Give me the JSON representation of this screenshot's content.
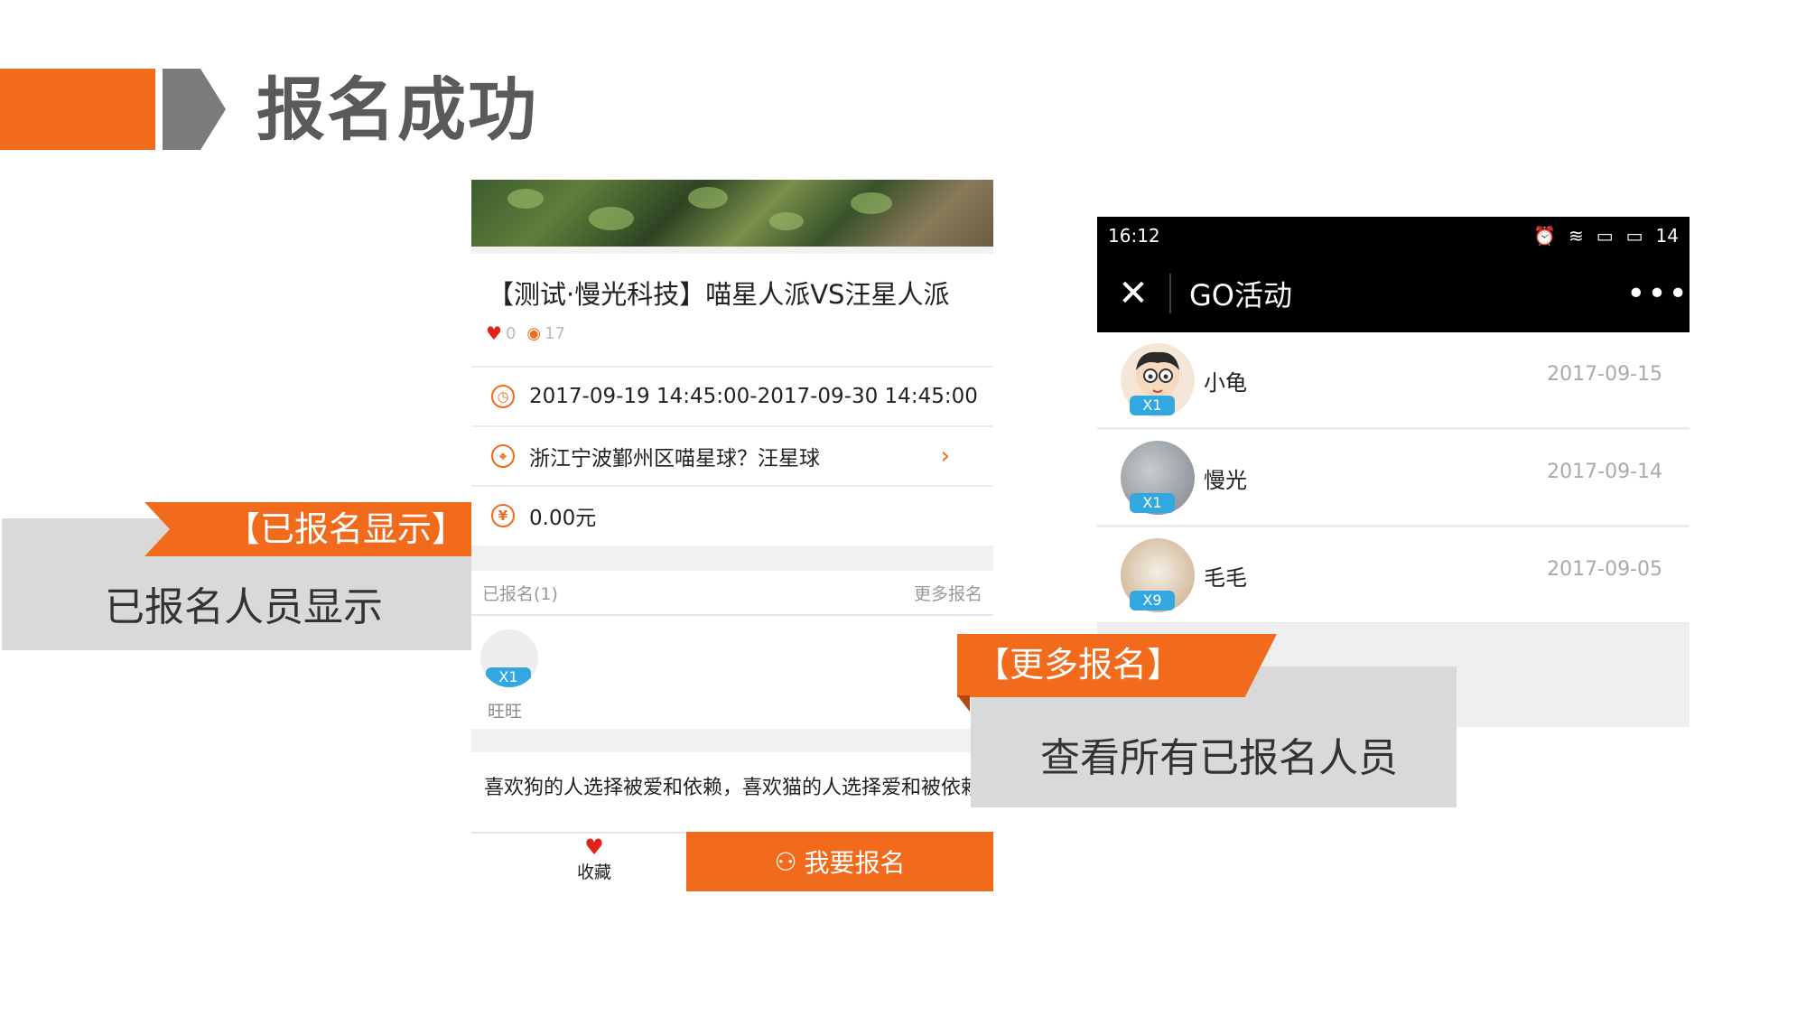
{
  "slide": {
    "title": "报名成功",
    "accent": "#f26b1d",
    "gray": "#7b7b7b"
  },
  "event_page": {
    "title": "【测试·慢光科技】喵星人派VS汪星人派",
    "likes": "0",
    "views": "17",
    "time": "2017-09-19 14:45:00-2017-09-30 14:45:00",
    "location": "浙江宁波鄞州区喵星球？汪星球",
    "price": "0.00元",
    "registered_label": "已报名(1)",
    "more_label": "更多报名",
    "attendee": {
      "name": "旺旺",
      "badge": "X1"
    },
    "description": "喜欢狗的人选择被爱和依赖，喜欢猫的人选择爱和被依赖",
    "favorite_label": "收藏",
    "join_label": "我要报名"
  },
  "callout_left": {
    "tag": "【已报名显示】",
    "text": "已报名人员显示"
  },
  "list_page": {
    "status_time": "16:12",
    "battery": "14",
    "nav_title": "GO活动",
    "items": [
      {
        "name": "小龟",
        "date": "2017-09-15",
        "badge": "X1"
      },
      {
        "name": "慢光",
        "date": "2017-09-14",
        "badge": "X1"
      },
      {
        "name": "毛毛",
        "date": "2017-09-05",
        "badge": "X9"
      }
    ]
  },
  "callout_right": {
    "tag": "【更多报名】",
    "text": "查看所有已报名人员"
  }
}
